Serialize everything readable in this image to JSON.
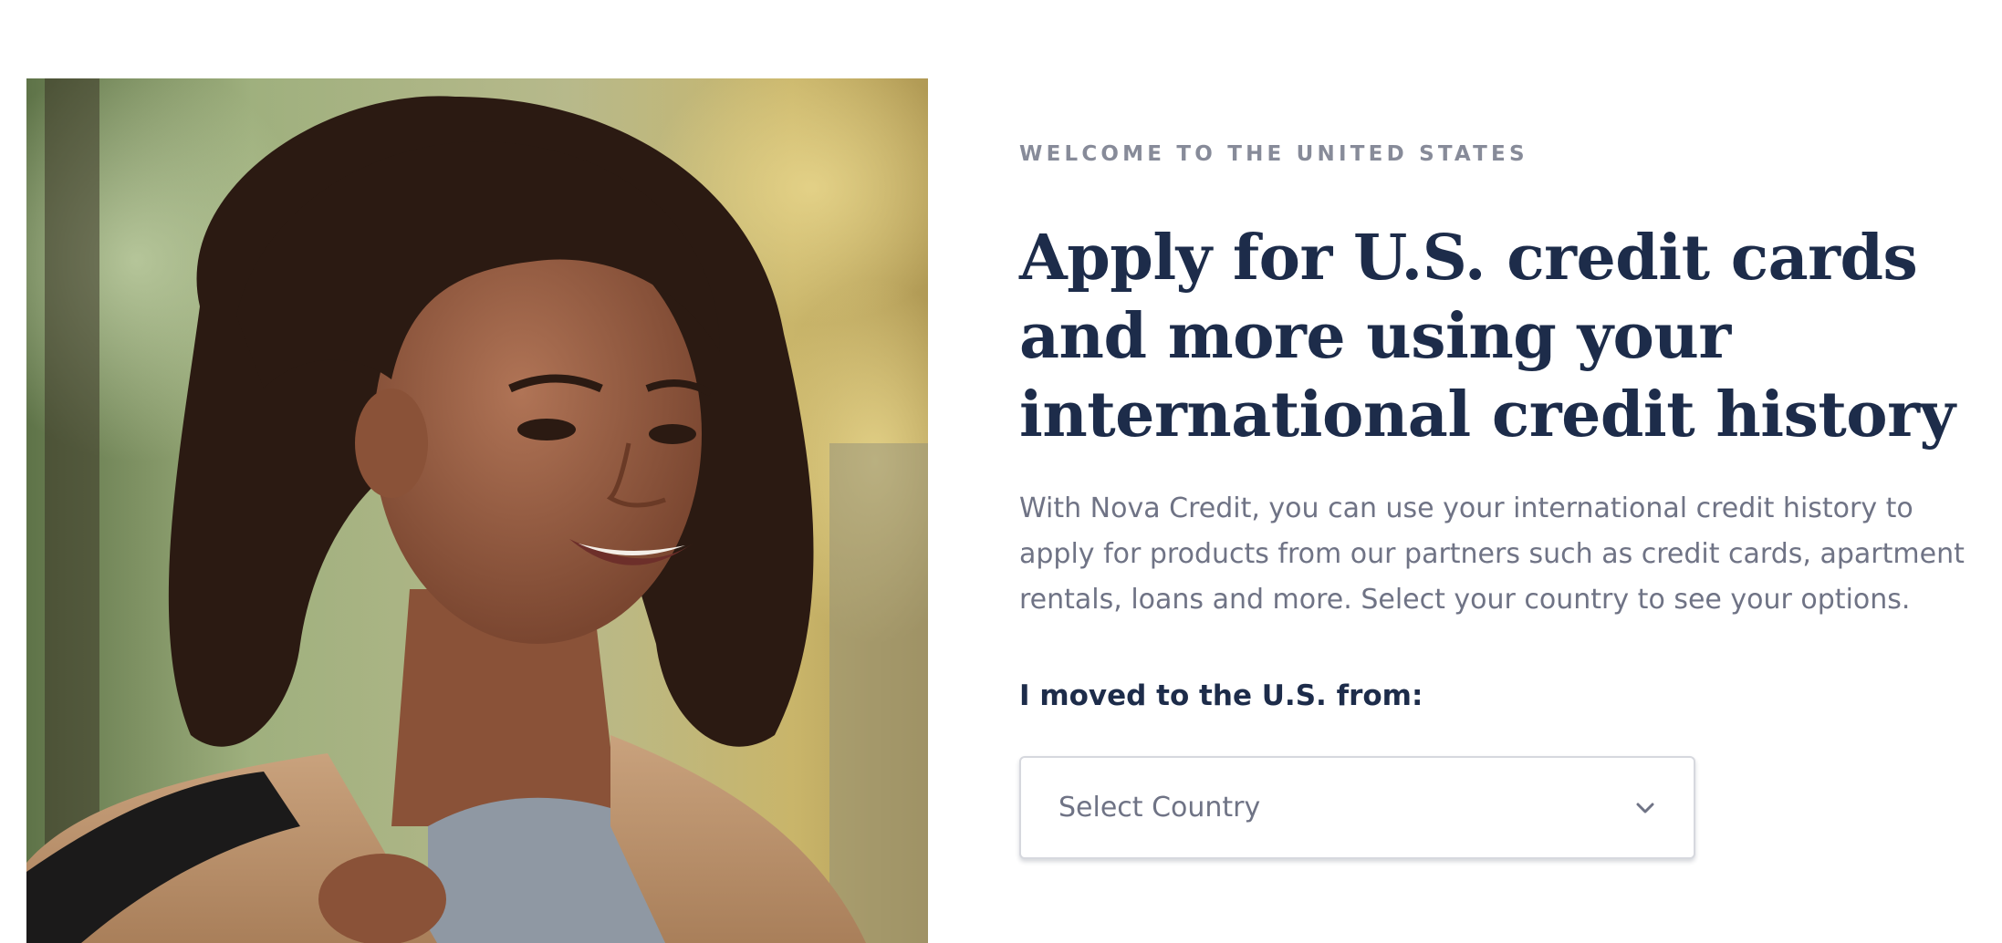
{
  "hero": {
    "image_alt": "Smiling woman with curly hair in a camel coat outdoors"
  },
  "intro": {
    "eyebrow": "WELCOME TO THE UNITED STATES",
    "headline": "Apply for U.S. credit cards and more using your international credit history",
    "body": "With Nova Credit, you can use your international credit history to apply for products from our partners such as credit cards, apartment rentals, loans and more. Select your country to see your options."
  },
  "country_picker": {
    "label": "I moved to the U.S. from:",
    "placeholder": "Select Country",
    "icon": "chevron-down-icon"
  },
  "colors": {
    "heading": "#1d2c4a",
    "body_text": "#6f7385",
    "eyebrow": "#878b99",
    "select_border": "#d6d8de"
  }
}
